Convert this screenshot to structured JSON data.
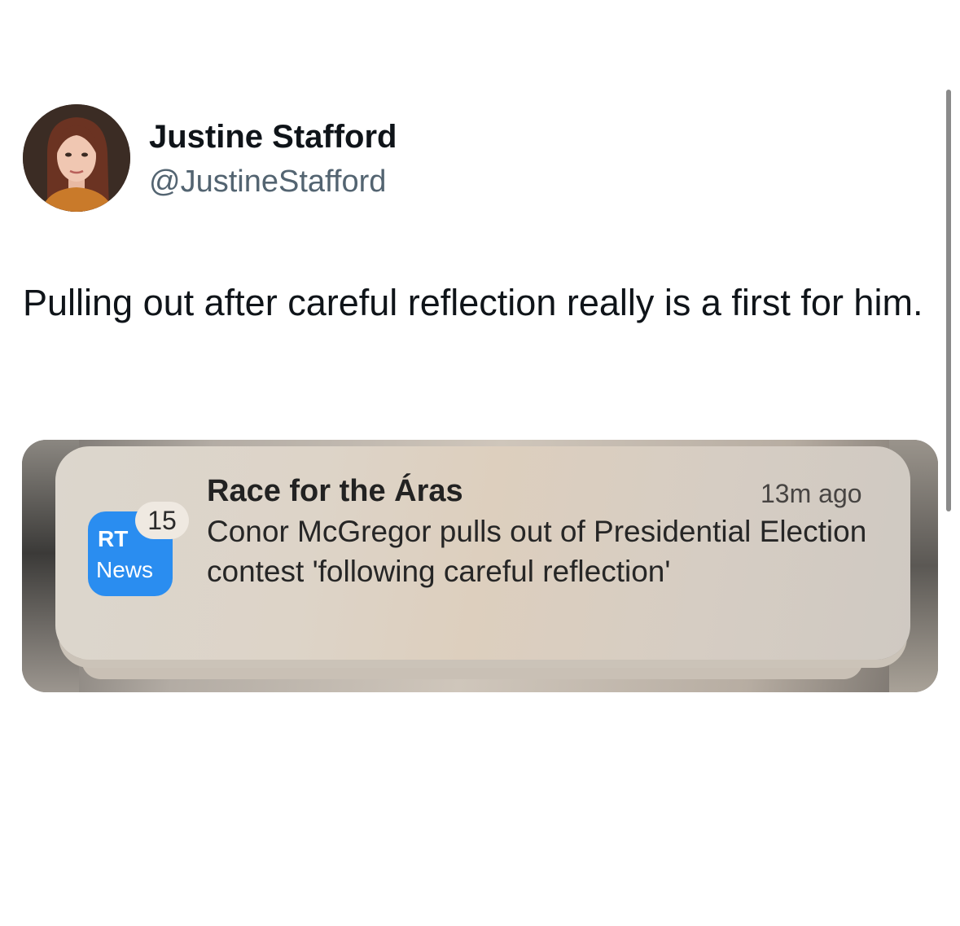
{
  "author": {
    "name": "Justine Stafford",
    "handle": "@JustineStafford"
  },
  "tweet": {
    "text": "Pulling out after careful reflection really is a first for him."
  },
  "notification": {
    "app_icon_top": "RT",
    "app_icon_bottom": "News",
    "badge_count": "15",
    "title": "Race for the Áras",
    "time": "13m ago",
    "body": "Conor McGregor pulls out of Presidential Election contest 'following careful reflection'",
    "app_color": "#2a8df0"
  }
}
